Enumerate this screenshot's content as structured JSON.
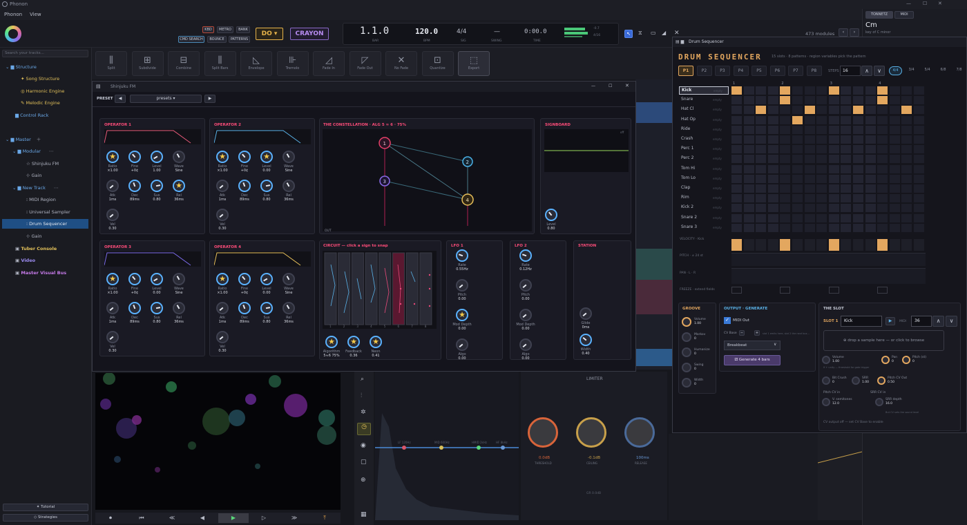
{
  "app": {
    "title": "Phonon",
    "menu": [
      "Phonon",
      "View"
    ]
  },
  "window_controls": {
    "minimize": "—",
    "maximize": "☐",
    "close": "✕"
  },
  "topbar": {
    "buttons_row1": [
      "KBD",
      "METRO",
      "BANK"
    ],
    "buttons_row2": [
      "CMD SEARCH",
      "BOUNCE",
      "PATTERNS"
    ],
    "key_button": "DO ▾",
    "preset_button": "CRAYON",
    "position": "1.1.0",
    "position_label": "BAR",
    "tempo": "120.0",
    "tempo_label": "BPM",
    "time_sig": "4/4",
    "time_sig_label": "SIG",
    "swing": "—",
    "swing_label": "SWING",
    "time": "0:00.0",
    "time_label": "TIME",
    "meter_label": "-0.7",
    "meter_label2": "4/16",
    "modules": "473 modules",
    "tonnetz_tab": "TONNETZ",
    "midi_tab": "MIDI",
    "chord": "Cm",
    "chord_sub": "key of C minor"
  },
  "sidebar": {
    "search_placeholder": "Search your tracks...",
    "items": [
      {
        "label": "Structure",
        "color": "#6aa8e8"
      },
      {
        "label": "Song Structure",
        "color": "#e2c05a"
      },
      {
        "label": "Harmonic Engine",
        "color": "#e2c05a"
      },
      {
        "label": "Melodic Engine",
        "color": "#e2c05a"
      },
      {
        "label": "Control Rack",
        "color": "#6aa8e8"
      },
      {
        "label": "Master",
        "color": "#6aa8e8"
      },
      {
        "label": "Modular",
        "color": "#6aa8e8"
      },
      {
        "label": "Shinjuku FM",
        "color": "#b8bcc8"
      },
      {
        "label": "Gain",
        "color": "#b8bcc8"
      },
      {
        "label": "New Track",
        "color": "#6aa8e8"
      },
      {
        "label": "MIDI Region",
        "color": "#b8bcc8"
      },
      {
        "label": "Universal Sampler",
        "color": "#b8bcc8"
      },
      {
        "label": "Drum Sequencer",
        "color": "#b8bcc8"
      },
      {
        "label": "Gain",
        "color": "#b8bcc8"
      },
      {
        "label": "Tuber Console",
        "color": "#e2c05a"
      },
      {
        "label": "Video",
        "color": "#9c8cf2"
      },
      {
        "label": "Master Visual Bus",
        "color": "#c57ae8"
      }
    ],
    "tutorial": "Tutorial",
    "strategies": "Strategies"
  },
  "tools": [
    "Split",
    "Subdivide",
    "Combine",
    "Split Bars",
    "Envelope",
    "Tremolo",
    "Fade In",
    "Fade Out",
    "No Fade",
    "Quantize",
    "Export"
  ],
  "fm": {
    "title": "Shinjuku FM",
    "preset_label": "PRESET",
    "preset_value": "presets ▾",
    "op1": "OPERATOR 1",
    "op2": "OPERATOR 2",
    "op3": "OPERATOR 3",
    "op4": "OPERATOR 4",
    "op_row1": [
      [
        "Ratio",
        "×1.00"
      ],
      [
        "Fine",
        "+0¢"
      ],
      [
        "Level",
        "1.00"
      ],
      [
        "Wave",
        "Sine"
      ]
    ],
    "op_row1b": [
      [
        "Ratio",
        "×1.00"
      ],
      [
        "Fine",
        "+0¢"
      ],
      [
        "Level",
        "0.00"
      ],
      [
        "Wave",
        "Sine"
      ]
    ],
    "op_row2": [
      [
        "Atk",
        "1ms"
      ],
      [
        "Dec",
        "89ms"
      ],
      [
        "Sus",
        "0.80"
      ],
      [
        "Rel",
        "36ms"
      ]
    ],
    "vel": "Vel",
    "vel_val": "0.30",
    "constellation": "THE CONSTELLATION · ALG 5 ≈ 6 · 75%",
    "out": "OUT",
    "signboard": "SIGNBOARD",
    "sig_off": "off",
    "level": "Level",
    "level_val": "0.80",
    "circuit": "CIRCUIT — click a sign to snap",
    "circuit_nums": [
      "1",
      "2",
      "3",
      "4",
      "5",
      "6",
      "7",
      "8"
    ],
    "algo": [
      "Algorithm",
      "5≈6 75%"
    ],
    "feedback": [
      "Feedback",
      "0.36"
    ],
    "neon": [
      "Neon",
      "0.41"
    ],
    "lfo1": "LFO 1",
    "lfo2": "LFO 2",
    "station": "STATION",
    "lfo1_knobs": [
      [
        "Rate",
        "0.55Hz"
      ],
      [
        "Pitch",
        "0.00"
      ],
      [
        "Mod Depth",
        "0.00"
      ],
      [
        "Algo",
        "0.00"
      ]
    ],
    "lfo2_knobs": [
      [
        "Rate",
        "0.12Hz"
      ],
      [
        "Pitch",
        "0.00"
      ],
      [
        "Mod Depth",
        "0.00"
      ],
      [
        "Algo",
        "0.00"
      ]
    ],
    "station_knobs": [
      [
        "Glide",
        "0ms"
      ],
      [
        "Width",
        "0.40"
      ]
    ]
  },
  "drum": {
    "window_title": "Drum Sequencer",
    "title": "DRUM SEQUENCER",
    "subtitle": "15 slots · 8 patterns · region variables pick the pattern",
    "patterns": [
      "P1",
      "P2",
      "P3",
      "P4",
      "P5",
      "P6",
      "P7",
      "P8"
    ],
    "steps_label": "STEPS",
    "steps_value": "16",
    "sigs": [
      "4/4",
      "3/4",
      "5/4",
      "6/8",
      "7/8"
    ],
    "rows": [
      "Kick",
      "Snare",
      "Hat Cl",
      "Hat Op",
      "Ride",
      "Crash",
      "Perc 1",
      "Perc 2",
      "Tom Hi",
      "Tom Lo",
      "Clap",
      "Rim",
      "Kick 2",
      "Snare 2",
      "Snare 3"
    ],
    "empty": "empty",
    "beat_nums": [
      "1",
      "2",
      "3",
      "4"
    ],
    "velocity_label": "VELOCITY · Kick",
    "pitch_label": "PITCH · ± 24 st",
    "pan_label": "PAN · L · R",
    "freeze_label": "FREEZE · extend fields",
    "groove": "GROOVE",
    "groove_knobs": [
      [
        "Volume",
        "1.00"
      ],
      [
        "Markov",
        "0"
      ],
      [
        "Humanize",
        "0"
      ],
      [
        "Swing",
        "0"
      ],
      [
        "Width",
        "0"
      ]
    ],
    "output": "OUTPUT · GENERATE",
    "midi_out": "MIDI Out",
    "cv_base": "CV Base",
    "cv_hint": "slot 1 emits here, slot 2 the next bus…",
    "breakbeat": "Breakbeat",
    "generate": "Generate 4 bars",
    "slot_title": "THE SLOT",
    "slot_label": "SLOT 1",
    "slot_name": "Kick",
    "midi_label": "MIDI",
    "midi_note": "36",
    "drop": "⊕ drop a sample here — or click to browse",
    "slot_knobs": [
      [
        "Volume",
        "1.00"
      ],
      [
        "Pan",
        "0"
      ],
      [
        "Pitch (st)",
        "0"
      ],
      [
        "Bit Crush",
        "0"
      ],
      [
        "SRR",
        "1.00"
      ],
      [
        "Pitch CV Out",
        "0.50"
      ],
      [
        "V. semitones",
        "12.0"
      ],
      [
        "SRR depth",
        "16.0"
      ]
    ],
    "cv_in1": "Pitch CV in",
    "cv_in2": "SRR CV in",
    "hint_gate": "If + unity — threshold for gate trigger",
    "hint_cv": "But CV sets the sound level",
    "cv_note": "CV output off — set CV Base to enable"
  },
  "limiter": {
    "title": "LIMITER",
    "knobs": [
      [
        "0.0dB",
        "THRESHOLD"
      ],
      [
        "-0.1dB",
        "CEILING"
      ],
      [
        "100ms",
        "RELEASE"
      ]
    ],
    "gr": "GR 0.0dB"
  },
  "eq_labels": [
    "LF 120Hz",
    "MID 600Hz",
    "HMID 2kHz",
    "HF 8kHz"
  ],
  "transport": [
    "⏺",
    "⏮",
    "≪",
    "◀",
    "▶",
    "▷",
    "≫",
    "⤒"
  ]
}
